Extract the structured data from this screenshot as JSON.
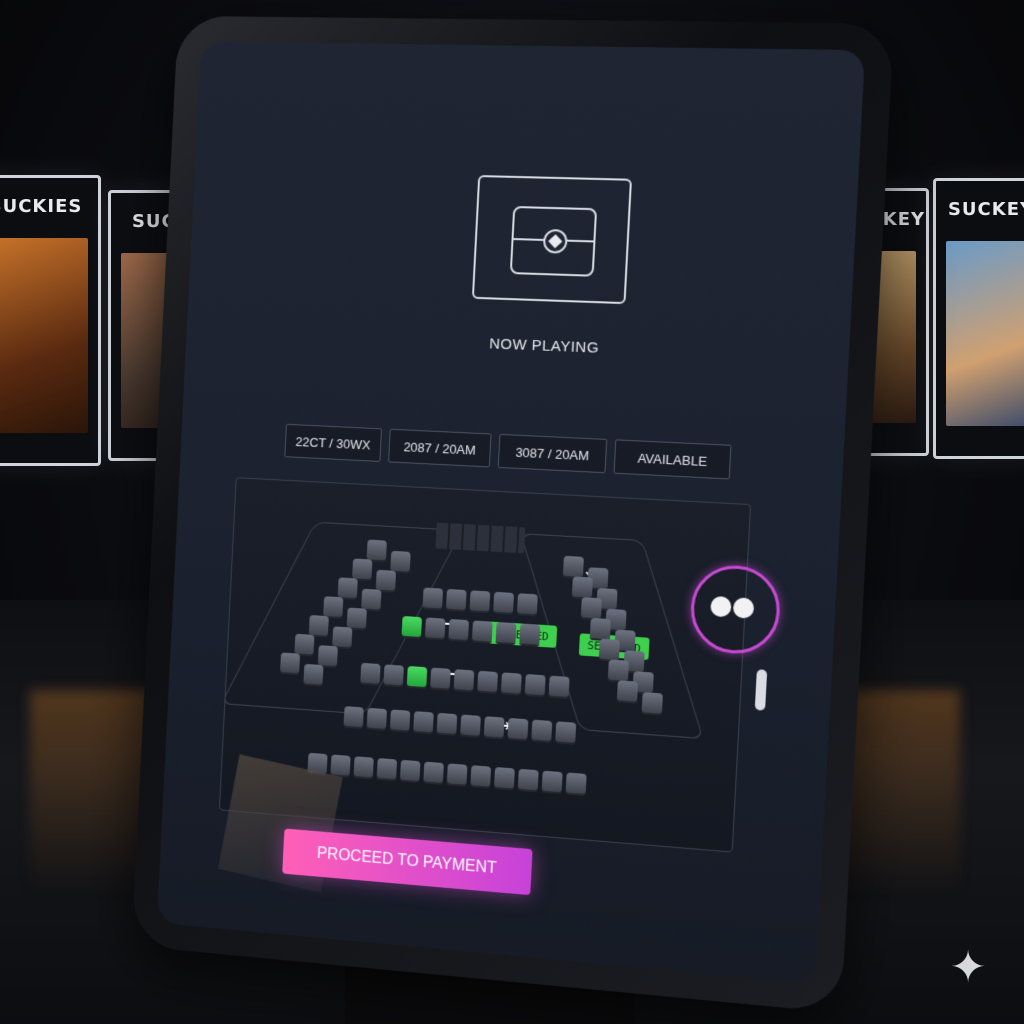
{
  "background": {
    "posters_left": [
      {
        "header": "SUCKIES"
      },
      {
        "header": "SUCKEY"
      }
    ],
    "posters_right": [
      {
        "header": "SUCKEY"
      },
      {
        "header": "SUCKEY"
      }
    ]
  },
  "kiosk": {
    "now_playing": "NOW PLAYING",
    "showtimes": [
      {
        "label": "22CT / 30WX"
      },
      {
        "label": "2087 / 20AM"
      },
      {
        "label": "3087 / 20AM"
      },
      {
        "label": "AVAILABLE"
      }
    ],
    "seat_map": {
      "selected_badges": [
        "SELECTED",
        "SELECTED"
      ]
    },
    "pay_button": "PROCEED TO PAYMENT"
  },
  "colors": {
    "accent_pink": "#ff5fb7",
    "accent_purple": "#c742d9",
    "selected_green": "#3fcf4f",
    "screen_bg": "#1f2532"
  },
  "icons": {
    "logo": "cinema-ticket-icon",
    "sparkle": "sparkle-icon"
  }
}
